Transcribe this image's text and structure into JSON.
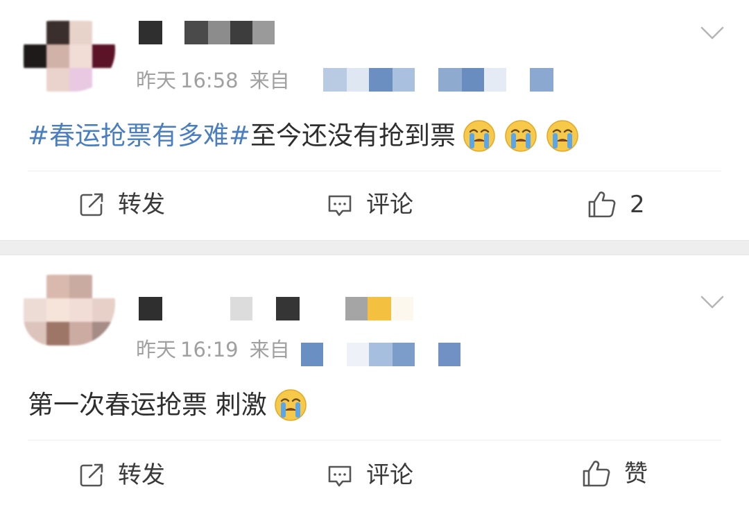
{
  "posts": [
    {
      "meta": {
        "day": "昨天",
        "time": "16:58",
        "from_label": "来自"
      },
      "content": {
        "topic": "#春运抢票有多难#",
        "text": "至今还没有抢到票",
        "emoji": [
          "crying-face",
          "crying-face",
          "crying-face"
        ]
      },
      "actions": {
        "repost": "转发",
        "comment": "评论",
        "like": "2"
      }
    },
    {
      "meta": {
        "day": "昨天",
        "time": "16:19",
        "from_label": "来自"
      },
      "content": {
        "text": "第一次春运抢票 刺激",
        "emoji": [
          "crying-face"
        ]
      },
      "actions": {
        "repost": "转发",
        "comment": "评论",
        "like": "赞"
      }
    }
  ],
  "colors": {
    "topic": "#4a7ebd",
    "meta_text": "#a0a0a0",
    "separator": "#eeeeee",
    "body_text": "#2e2e2e"
  },
  "icons": [
    "chevron-down-icon",
    "repost-icon",
    "comment-icon",
    "thumbs-up-icon",
    "crying-face-emoji"
  ]
}
